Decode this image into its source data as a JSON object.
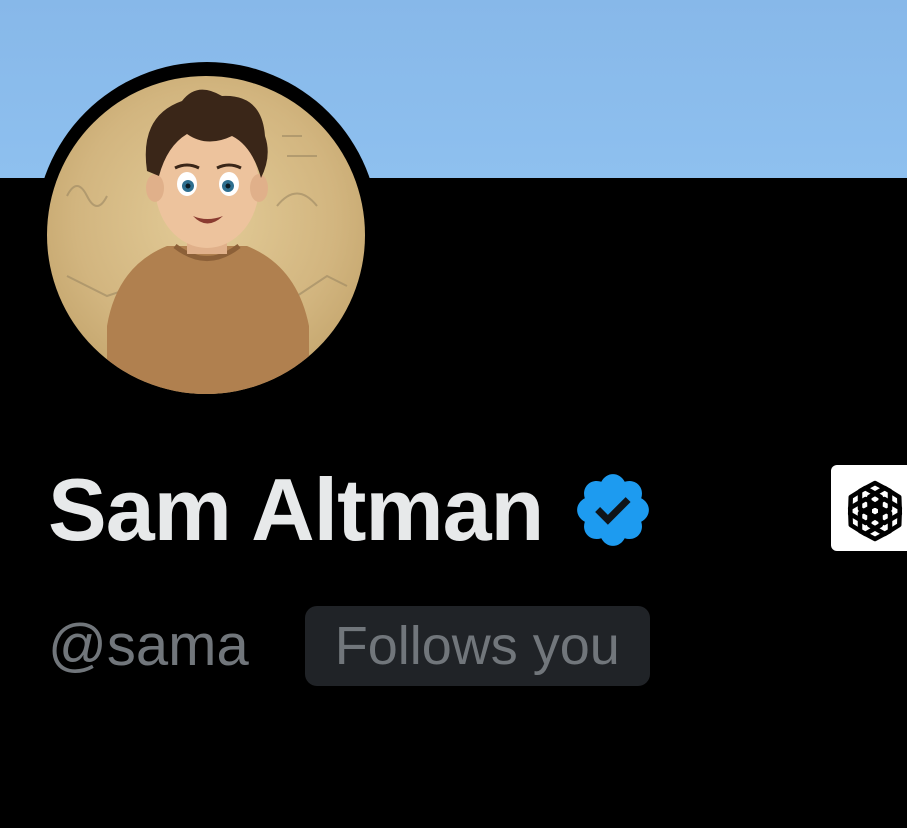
{
  "profile": {
    "display_name": "Sam Altman",
    "handle": "@sama",
    "follows_you_label": "Follows you",
    "verified_badge": "verified-check-icon",
    "affiliation_badge": "openai-logo-icon",
    "avatar": "anime-style-portrait"
  },
  "colors": {
    "banner": "#8ec0ef",
    "background": "#000000",
    "name_text": "#e7e9ea",
    "secondary_text": "#71767b",
    "badge_bg": "#202327",
    "verified_blue": "#1d9bf0"
  }
}
